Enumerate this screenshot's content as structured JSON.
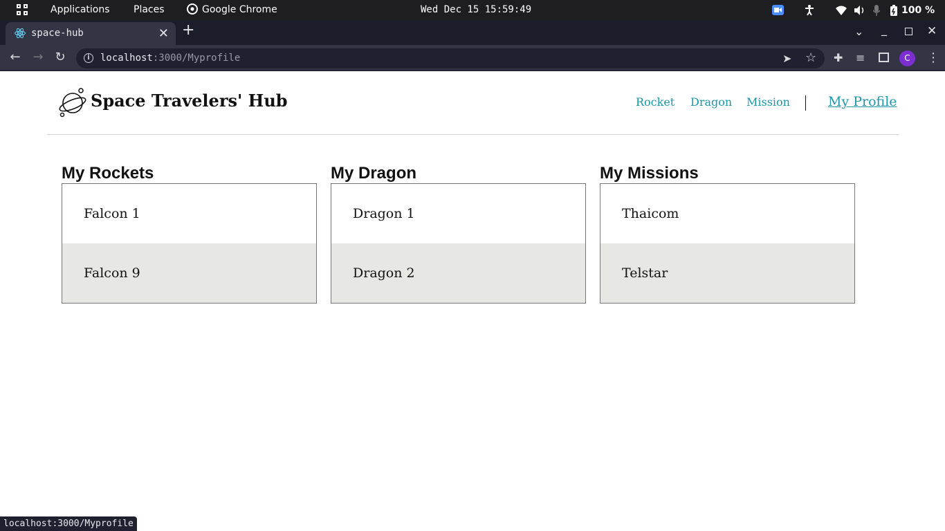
{
  "system_bar": {
    "applications_label": "Applications",
    "places_label": "Places",
    "active_app_label": "Google Chrome",
    "clock": "Wed Dec 15  15:59:49",
    "battery": "100 %"
  },
  "browser": {
    "tab_title": "space-hub",
    "url_host": "localhost",
    "url_path": ":3000/Myprofile",
    "profile_initial": "C",
    "status_url": "localhost:3000/Myprofile"
  },
  "site": {
    "brand": "Space Travelers' Hub",
    "nav": {
      "rocket": "Rocket",
      "dragon": "Dragon",
      "mission": "Mission",
      "profile": "My Profile"
    },
    "colors": {
      "link": "#1b97a8",
      "row_alt": "#e7e8e4"
    }
  },
  "profile": {
    "rockets": {
      "title": "My Rockets",
      "items": [
        "Falcon 1",
        "Falcon 9"
      ]
    },
    "dragons": {
      "title": "My Dragon",
      "items": [
        "Dragon 1",
        "Dragon 2"
      ]
    },
    "missions": {
      "title": "My Missions",
      "items": [
        "Thaicom",
        "Telstar"
      ]
    }
  }
}
